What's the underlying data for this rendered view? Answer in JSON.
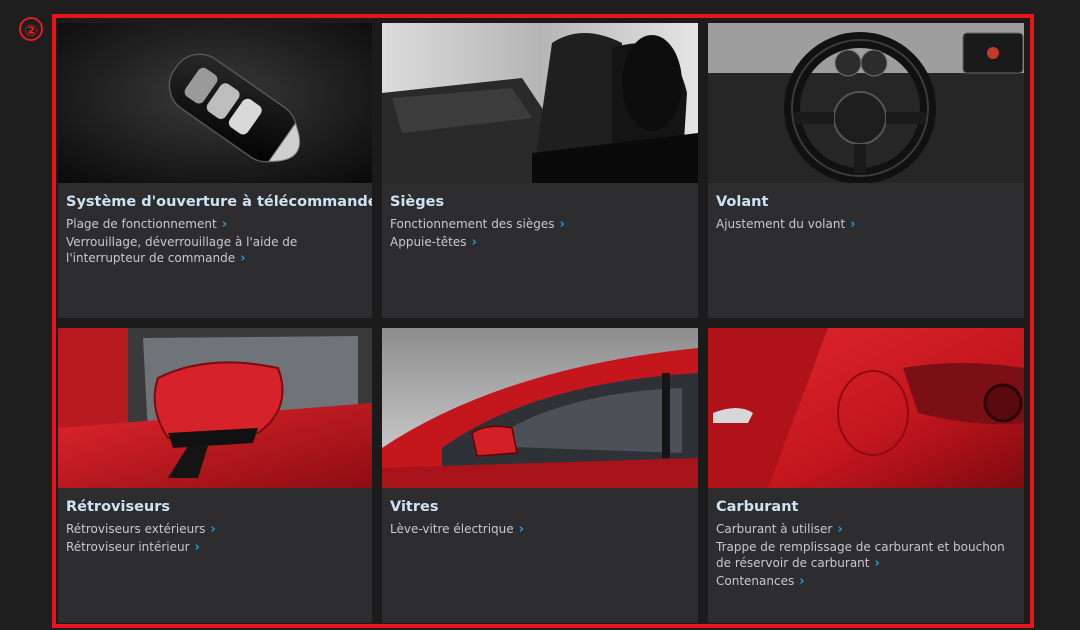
{
  "marker": "②",
  "cards": [
    {
      "title": "Système d'ouverture à télécommande",
      "links": [
        "Plage de fonctionnement",
        "Verrouillage, déverrouillage à l'aide de l'interrupteur de commande"
      ]
    },
    {
      "title": "Sièges",
      "links": [
        "Fonctionnement des sièges",
        "Appuie-têtes"
      ]
    },
    {
      "title": "Volant",
      "links": [
        "Ajustement du volant"
      ]
    },
    {
      "title": "Rétroviseurs",
      "links": [
        "Rétroviseurs extérieurs",
        "Rétroviseur intérieur"
      ]
    },
    {
      "title": "Vitres",
      "links": [
        "Lève-vitre électrique"
      ]
    },
    {
      "title": "Carburant",
      "links": [
        "Carburant à utiliser",
        "Trappe de remplissage de carburant et bouchon de réservoir de carburant",
        "Contenances"
      ]
    }
  ],
  "colors": {
    "frame": "#e8141b",
    "title": "#cfe2f3",
    "chevron": "#1e9be6",
    "card_bg": "#2d2d2f"
  },
  "icons": {
    "link_chevron": "chevron-right-icon"
  }
}
